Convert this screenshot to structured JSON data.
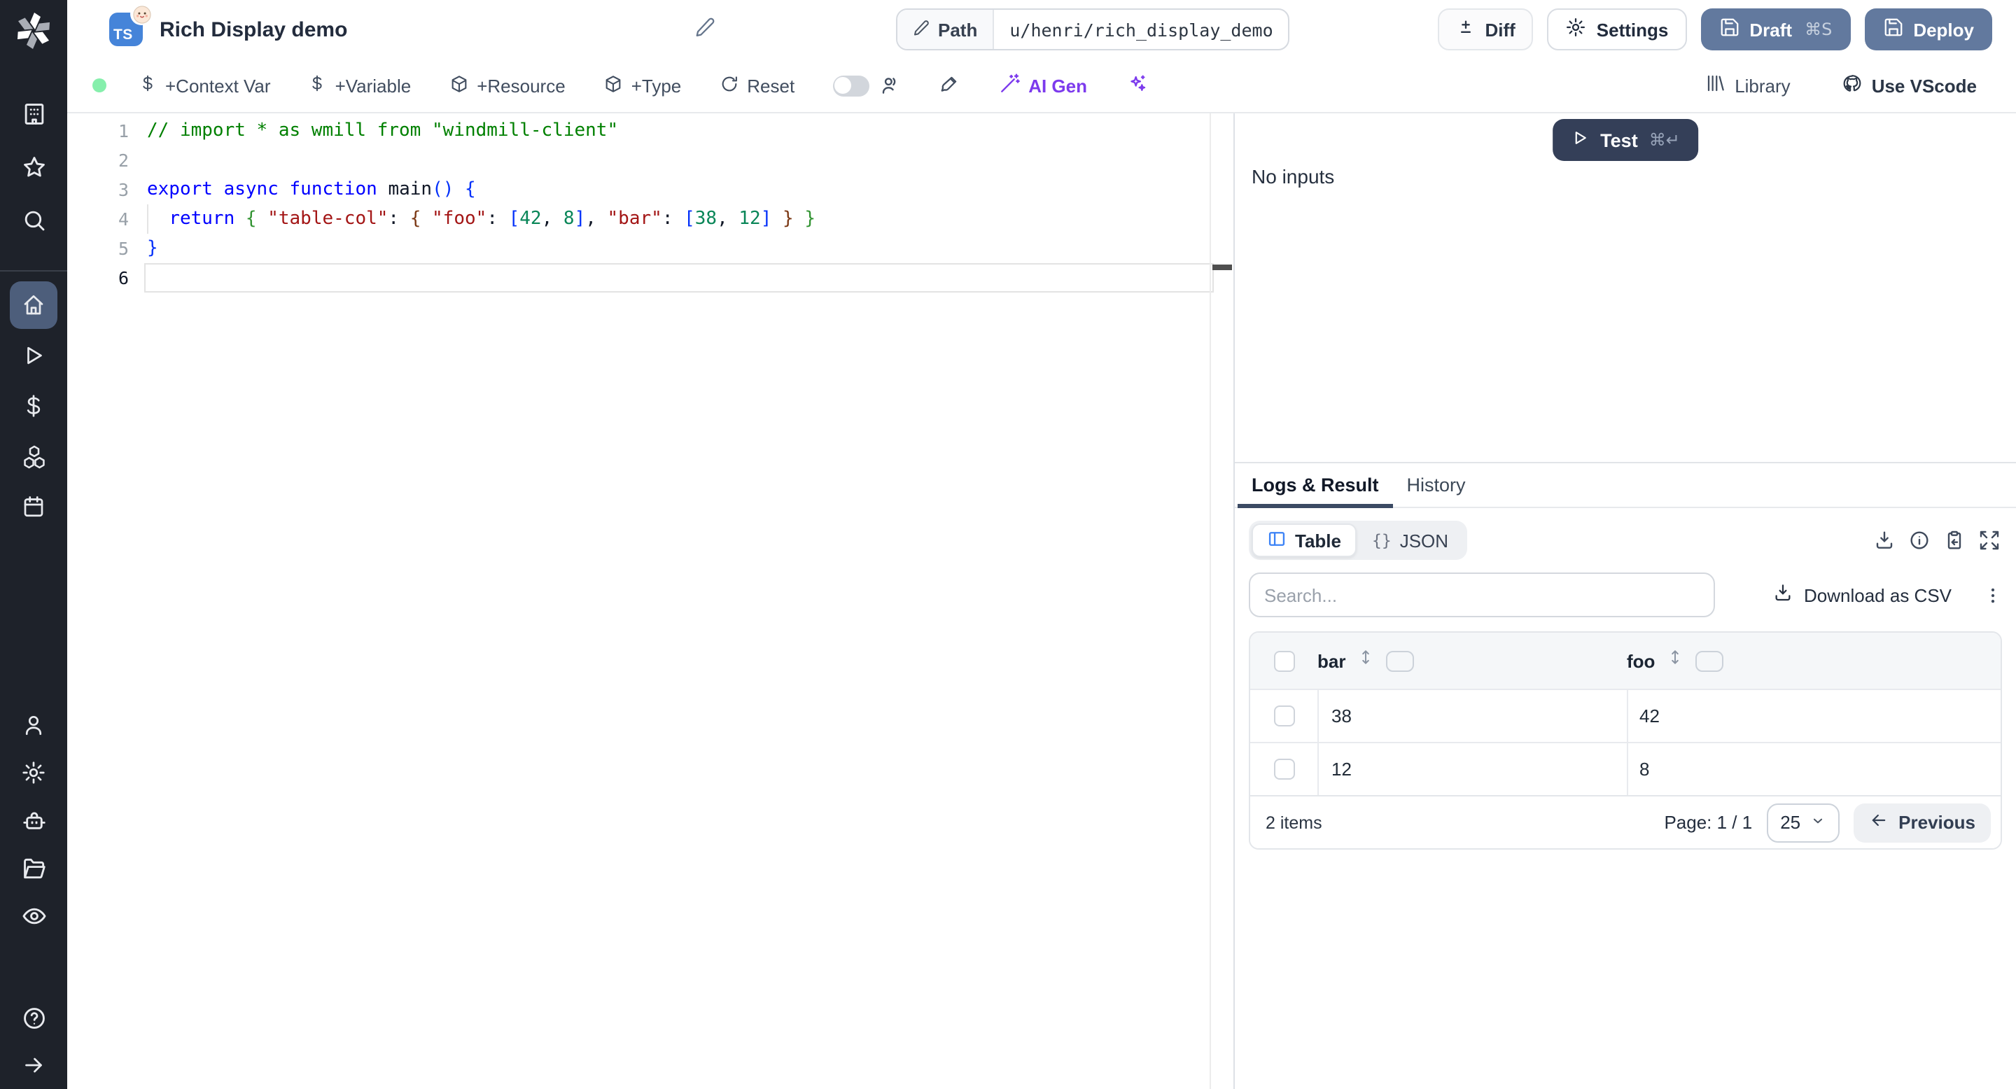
{
  "header": {
    "app_icon_label": "TS",
    "title": "Rich Display demo",
    "path_label": "Path",
    "path_value": "u/henri/rich_display_demo",
    "diff_label": "Diff",
    "settings_label": "Settings",
    "draft_label": "Draft",
    "draft_shortcut": "⌘S",
    "deploy_label": "Deploy"
  },
  "toolbar": {
    "add_context_var": "+Context Var",
    "add_variable": "+Variable",
    "add_resource": "+Resource",
    "add_type": "+Type",
    "reset": "Reset",
    "ai_gen": "AI Gen",
    "library": "Library",
    "use_vscode": "Use VScode"
  },
  "editor": {
    "language": "typescript",
    "lines": [
      {
        "n": 1,
        "tokens": [
          {
            "c": "comment",
            "t": "// import * as wmill from \"windmill-client\""
          }
        ]
      },
      {
        "n": 2,
        "tokens": []
      },
      {
        "n": 3,
        "tokens": [
          {
            "c": "kw",
            "t": "export"
          },
          {
            "t": " "
          },
          {
            "c": "kw",
            "t": "async"
          },
          {
            "t": " "
          },
          {
            "c": "kw",
            "t": "function"
          },
          {
            "t": " "
          },
          {
            "c": "fn",
            "t": "main"
          },
          {
            "c": "b1",
            "t": "()"
          },
          {
            "t": " "
          },
          {
            "c": "b1",
            "t": "{"
          }
        ]
      },
      {
        "n": 4,
        "guide": true,
        "tokens": [
          {
            "t": "  "
          },
          {
            "c": "kw",
            "t": "return"
          },
          {
            "t": " "
          },
          {
            "c": "b2",
            "t": "{"
          },
          {
            "t": " "
          },
          {
            "c": "str",
            "t": "\"table-col\""
          },
          {
            "t": ": "
          },
          {
            "c": "b3",
            "t": "{"
          },
          {
            "t": " "
          },
          {
            "c": "str",
            "t": "\"foo\""
          },
          {
            "t": ": "
          },
          {
            "c": "b1",
            "t": "["
          },
          {
            "c": "num",
            "t": "42"
          },
          {
            "t": ", "
          },
          {
            "c": "num",
            "t": "8"
          },
          {
            "c": "b1",
            "t": "]"
          },
          {
            "t": ", "
          },
          {
            "c": "str",
            "t": "\"bar\""
          },
          {
            "t": ": "
          },
          {
            "c": "b1",
            "t": "["
          },
          {
            "c": "num",
            "t": "38"
          },
          {
            "t": ", "
          },
          {
            "c": "num",
            "t": "12"
          },
          {
            "c": "b1",
            "t": "]"
          },
          {
            "t": " "
          },
          {
            "c": "b3",
            "t": "}"
          },
          {
            "t": " "
          },
          {
            "c": "b2",
            "t": "}"
          }
        ]
      },
      {
        "n": 5,
        "tokens": [
          {
            "c": "b1",
            "t": "}"
          }
        ]
      },
      {
        "n": 6,
        "active": true,
        "tokens": []
      }
    ]
  },
  "run_panel": {
    "test_label": "Test",
    "test_shortcut": "⌘↵",
    "no_inputs": "No inputs"
  },
  "result_panel": {
    "tabs": [
      {
        "label": "Logs & Result",
        "active": true
      },
      {
        "label": "History",
        "active": false
      }
    ],
    "view_toggle": {
      "table_label": "Table",
      "json_glyph": "{}",
      "json_label": "JSON"
    },
    "action_icons": [
      "download-icon",
      "info-icon",
      "paste-icon",
      "expand-icon"
    ],
    "search_placeholder": "Search...",
    "download_csv_label": "Download as CSV",
    "table": {
      "columns": [
        "bar",
        "foo"
      ],
      "rows": [
        [
          "38",
          "42"
        ],
        [
          "12",
          "8"
        ]
      ],
      "items_count": "2 items",
      "page_label": "Page: 1 / 1",
      "page_size": "25",
      "previous_label": "Previous"
    }
  },
  "sidebar": {
    "items": [
      "workspace",
      "favorites",
      "search",
      "home",
      "runs",
      "variables",
      "resources",
      "schedules",
      "users",
      "settings",
      "workers",
      "folders",
      "audit-logs",
      "help",
      "collapse"
    ],
    "active_item": "home"
  },
  "colors": {
    "accent_slate": "#62799e",
    "test_navy": "#343f58",
    "ai_purple": "#7c3aed",
    "table_blue": "#3b82f6",
    "status_green": "#86efac",
    "sidebar_bg": "#1e222a",
    "active_item_bg": "#4d5e7b"
  }
}
